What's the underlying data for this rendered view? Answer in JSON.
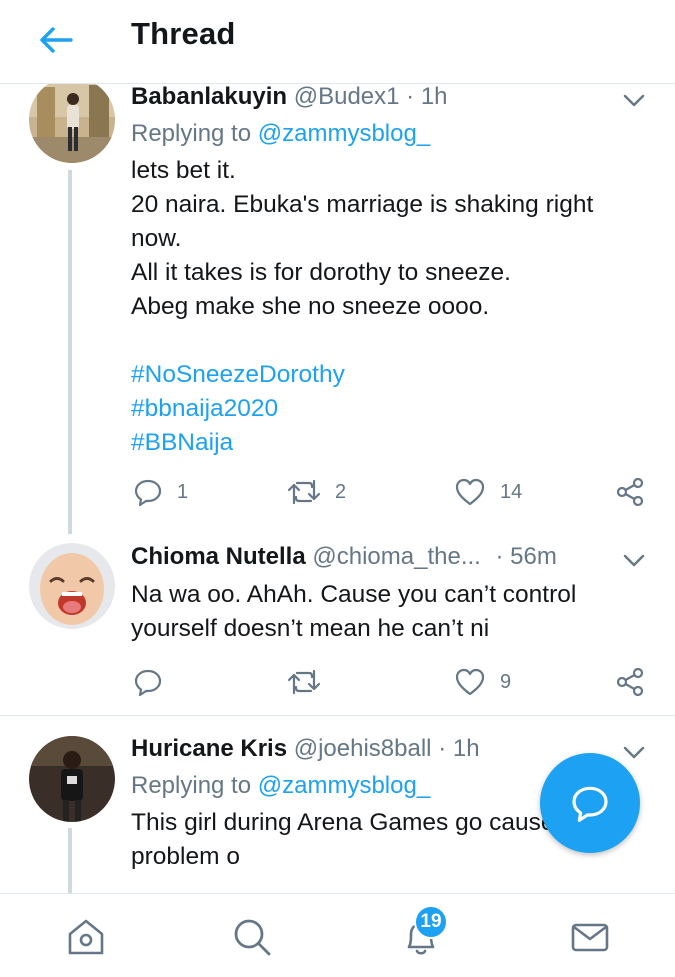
{
  "header": {
    "title": "Thread",
    "back_icon": "arrow-left-icon"
  },
  "colors": {
    "accent": "#1da1f2",
    "muted": "#657786",
    "text": "#14171a",
    "divider": "#e1e8ed"
  },
  "tweets": [
    {
      "name": "Babanlakuyin",
      "handle": "@Budex1",
      "dot": "·",
      "time": "1h",
      "replying_prefix": "Replying to",
      "replying_handle": "@zammysblog_",
      "lines": [
        "lets bet it.",
        "20 naira. Ebuka's marriage is shaking right",
        "now.",
        "All it takes is for dorothy to sneeze.",
        "Abeg make she no sneeze oooo."
      ],
      "hashtags": [
        "#NoSneezeDorothy",
        "#bbnaija2020",
        "#BBNaija"
      ],
      "replies": "1",
      "retweets": "2",
      "likes": "14"
    },
    {
      "name": "Chioma Nutella",
      "handle": "@chioma_the...",
      "dot": "·",
      "time": "56m",
      "lines": [
        "Na wa oo. AhAh. Cause you can’t control",
        "yourself doesn’t mean he can’t ni"
      ],
      "replies": "",
      "retweets": "",
      "likes": "9"
    },
    {
      "name": "Huricane Kris",
      "handle": "@joehis8ball",
      "dot": "·",
      "time": "1h",
      "replying_prefix": "Replying to",
      "replying_handle": "@zammysblog_",
      "lines": [
        "This girl during Arena Games go cause",
        "problem o"
      ]
    }
  ],
  "bottom_nav": {
    "items": [
      "home-icon",
      "search-icon",
      "notifications-icon",
      "messages-icon"
    ],
    "notification_count": "19"
  },
  "fab_icon": "reply-bubble-icon"
}
